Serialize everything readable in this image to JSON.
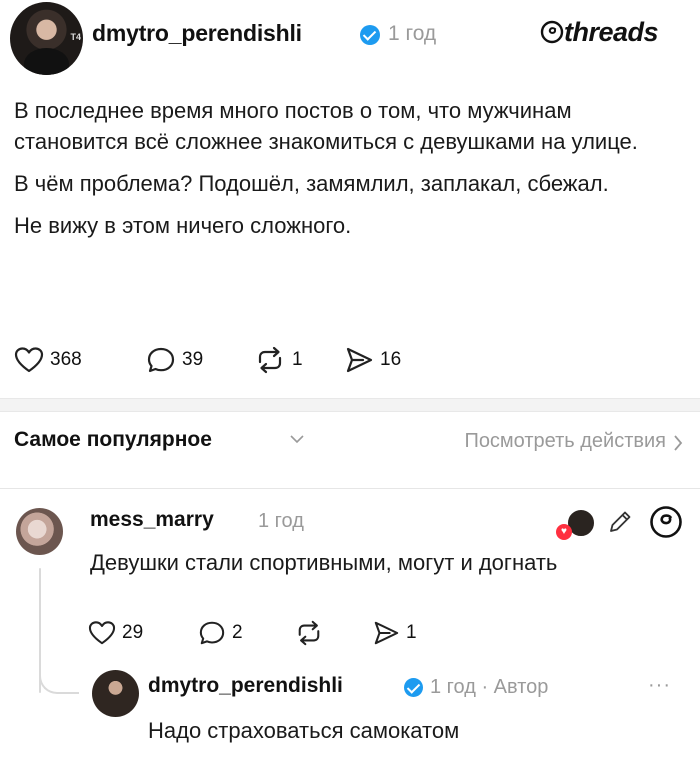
{
  "post": {
    "username": "dmytro_perendishli",
    "time": "1 год",
    "brand": "threads",
    "lines": [
      "В последнее время много постов о том, что мужчинам становится всё сложнее знакомиться с девушками на улице.",
      "В чём проблема? Подошёл, замямлил, заплакал, сбежал.",
      "Не вижу в этом ничего сложного."
    ],
    "likes": "368",
    "comments": "39",
    "reposts": "1",
    "shares": "16"
  },
  "sort": {
    "label": "Самое популярное",
    "view_activity": "Посмотреть действия"
  },
  "reply": {
    "username": "mess_marry",
    "time": "1 год",
    "text": "Девушки стали спортивными, могут и догнать",
    "likes": "29",
    "comments": "2",
    "shares": "1"
  },
  "author_reply": {
    "username": "dmytro_perendishli",
    "meta": "1 год · Автор",
    "more": "···",
    "text": "Надо страховаться самокатом"
  },
  "colors": {
    "verified": "#1d9bf0",
    "heart": "#ff3040",
    "muted": "#9a9a9a"
  }
}
